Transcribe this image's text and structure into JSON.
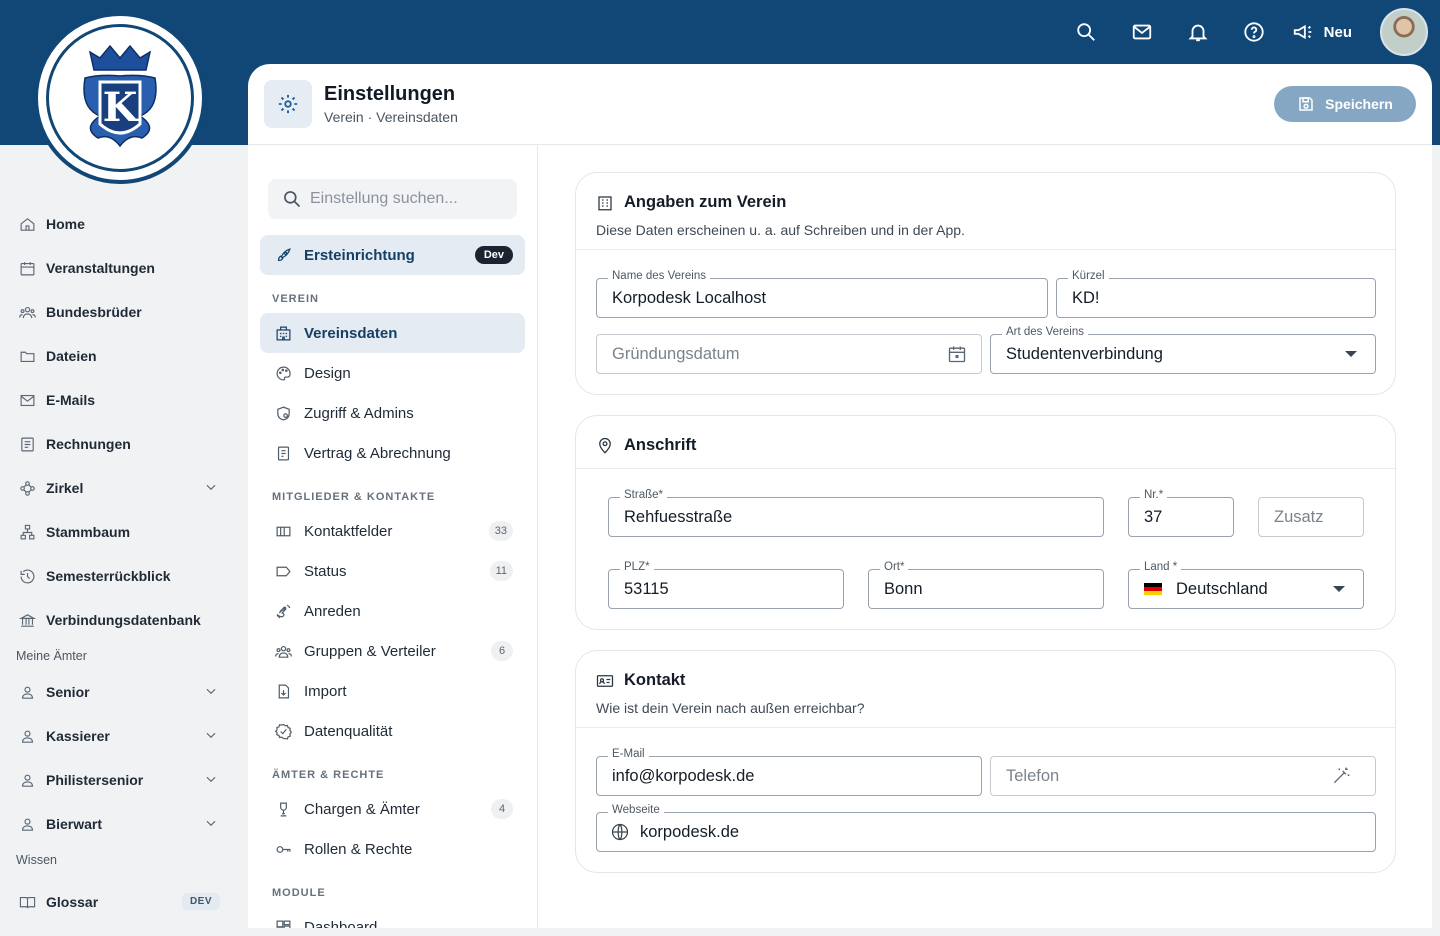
{
  "topbar": {
    "neu_label": "Neu",
    "icons": [
      "search-icon",
      "mail-icon",
      "bell-icon",
      "help-icon",
      "megaphone-icon"
    ]
  },
  "sidebar": {
    "items": [
      {
        "label": "Home",
        "icon": "home-icon"
      },
      {
        "label": "Veranstaltungen",
        "icon": "calendar-icon"
      },
      {
        "label": "Bundesbrüder",
        "icon": "people-icon"
      },
      {
        "label": "Dateien",
        "icon": "folder-icon"
      },
      {
        "label": "E-Mails",
        "icon": "mail-icon"
      },
      {
        "label": "Rechnungen",
        "icon": "receipt-icon"
      },
      {
        "label": "Zirkel",
        "icon": "zirkel-icon",
        "expandable": true
      },
      {
        "label": "Stammbaum",
        "icon": "tree-icon"
      },
      {
        "label": "Semesterrückblick",
        "icon": "history-icon"
      },
      {
        "label": "Verbindungsdatenbank",
        "icon": "institution-icon"
      }
    ],
    "section_aemter": "Meine Ämter",
    "aemter": [
      {
        "label": "Senior"
      },
      {
        "label": "Kassierer"
      },
      {
        "label": "Philistersenior"
      },
      {
        "label": "Bierwart"
      }
    ],
    "section_wissen": "Wissen",
    "wissen": [
      {
        "label": "Glossar",
        "badge": "DEV"
      }
    ]
  },
  "header": {
    "title": "Einstellungen",
    "breadcrumb": "Verein · Vereinsdaten",
    "save_label": "Speichern"
  },
  "settings_nav": {
    "search_placeholder": "Einstellung suchen...",
    "top_item": {
      "label": "Ersteinrichtung",
      "badge": "Dev"
    },
    "sections": [
      {
        "title": "VEREIN",
        "items": [
          {
            "label": "Vereinsdaten",
            "active": true
          },
          {
            "label": "Design"
          },
          {
            "label": "Zugriff & Admins"
          },
          {
            "label": "Vertrag & Abrechnung"
          }
        ]
      },
      {
        "title": "MITGLIEDER & KONTAKTE",
        "items": [
          {
            "label": "Kontaktfelder",
            "count": "33"
          },
          {
            "label": "Status",
            "count": "11"
          },
          {
            "label": "Anreden"
          },
          {
            "label": "Gruppen & Verteiler",
            "count": "6"
          },
          {
            "label": "Import"
          },
          {
            "label": "Datenqualität"
          }
        ]
      },
      {
        "title": "ÄMTER & RECHTE",
        "items": [
          {
            "label": "Chargen & Ämter",
            "count": "4"
          },
          {
            "label": "Rollen & Rechte"
          }
        ]
      },
      {
        "title": "MODULE",
        "items": [
          {
            "label": "Dashboard"
          }
        ]
      }
    ]
  },
  "verein_card": {
    "title": "Angaben zum Verein",
    "desc": "Diese Daten erscheinen u. a. auf Schreiben und in der App.",
    "name_label": "Name des Vereins",
    "name_value": "Korpodesk Localhost",
    "kuerzel_label": "Kürzel",
    "kuerzel_value": "KD!",
    "gruendung_placeholder": "Gründungsdatum",
    "art_label": "Art des Vereins",
    "art_value": "Studentenverbindung"
  },
  "anschrift_card": {
    "title": "Anschrift",
    "strasse_label": "Straße*",
    "strasse_value": "Rehfuesstraße",
    "nr_label": "Nr.*",
    "nr_value": "37",
    "zusatz_placeholder": "Zusatz",
    "plz_label": "PLZ*",
    "plz_value": "53115",
    "ort_label": "Ort*",
    "ort_value": "Bonn",
    "land_label": "Land *",
    "land_value": "Deutschland"
  },
  "kontakt_card": {
    "title": "Kontakt",
    "desc": "Wie ist dein Verein nach außen erreichbar?",
    "email_label": "E-Mail",
    "email_value": "info@korpodesk.de",
    "telefon_placeholder": "Telefon",
    "webseite_label": "Webseite",
    "webseite_value": "korpodesk.de"
  }
}
